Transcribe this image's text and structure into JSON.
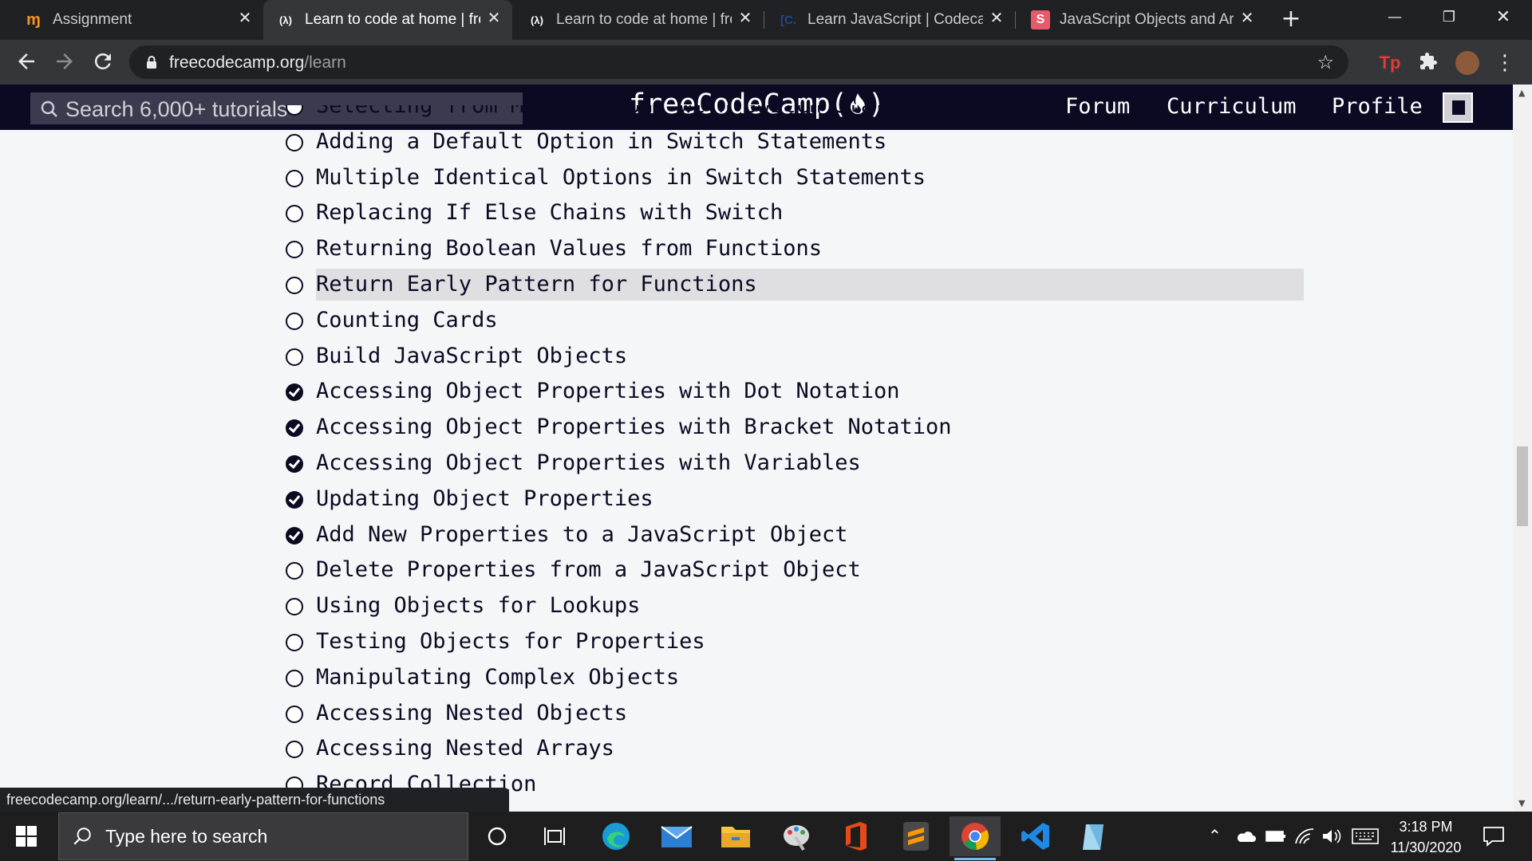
{
  "browser": {
    "tabs": [
      {
        "favicon": "amplify-logo",
        "title": "Assignment",
        "active": false
      },
      {
        "favicon": "freecodecamp-logo",
        "title": "Learn to code at home | freeCodeCamp.org",
        "active": true
      },
      {
        "favicon": "freecodecamp-logo",
        "title": "Learn to code at home | freeCodeCamp.org",
        "active": false
      },
      {
        "favicon": "codecademy-logo",
        "title": "Learn JavaScript | Codecademy",
        "active": false
      },
      {
        "favicon": "scrimba-logo",
        "title": "JavaScript Objects and Arrays",
        "active": false
      }
    ],
    "url_host": "freecodecamp.org",
    "url_path": "/learn",
    "window_controls": [
      "minimize",
      "restore",
      "close"
    ]
  },
  "fcc": {
    "search_placeholder": "Search 6,000+ tutorials",
    "logo": "freeCodeCamp(🔥)",
    "logo_text": "freeCodeCamp(",
    "logo_end": ")",
    "nav": {
      "forum": "Forum",
      "curriculum": "Curriculum",
      "profile": "Profile"
    }
  },
  "lessons": [
    {
      "title": "Selecting from Many Options with Switch Statements",
      "completed": false
    },
    {
      "title": "Adding a Default Option in Switch Statements",
      "completed": false
    },
    {
      "title": "Multiple Identical Options in Switch Statements",
      "completed": false
    },
    {
      "title": "Replacing If Else Chains with Switch",
      "completed": false
    },
    {
      "title": "Returning Boolean Values from Functions",
      "completed": false
    },
    {
      "title": "Return Early Pattern for Functions",
      "completed": false,
      "hovered": true
    },
    {
      "title": "Counting Cards",
      "completed": false
    },
    {
      "title": "Build JavaScript Objects",
      "completed": false
    },
    {
      "title": "Accessing Object Properties with Dot Notation",
      "completed": true
    },
    {
      "title": "Accessing Object Properties with Bracket Notation",
      "completed": true
    },
    {
      "title": "Accessing Object Properties with Variables",
      "completed": true
    },
    {
      "title": "Updating Object Properties",
      "completed": true
    },
    {
      "title": "Add New Properties to a JavaScript Object",
      "completed": true
    },
    {
      "title": "Delete Properties from a JavaScript Object",
      "completed": false
    },
    {
      "title": "Using Objects for Lookups",
      "completed": false
    },
    {
      "title": "Testing Objects for Properties",
      "completed": false
    },
    {
      "title": "Manipulating Complex Objects",
      "completed": false
    },
    {
      "title": "Accessing Nested Objects",
      "completed": false
    },
    {
      "title": "Accessing Nested Arrays",
      "completed": false
    },
    {
      "title": "Record Collection",
      "completed": false
    }
  ],
  "status_bar": "freecodecamp.org/learn/.../return-early-pattern-for-functions",
  "taskbar": {
    "search_placeholder": "Type here to search",
    "apps": [
      "cortana",
      "task-view",
      "edge",
      "mail",
      "file-explorer",
      "paint",
      "office",
      "sublime-text",
      "chrome",
      "vscode",
      "notepad"
    ],
    "time": "3:18 PM",
    "date": "11/30/2020"
  },
  "colors": {
    "fcc_navy": "#0a0a23",
    "fcc_search": "#3b3b4f",
    "chrome_dark": "#202124",
    "chrome_toolbar": "#35363a"
  }
}
